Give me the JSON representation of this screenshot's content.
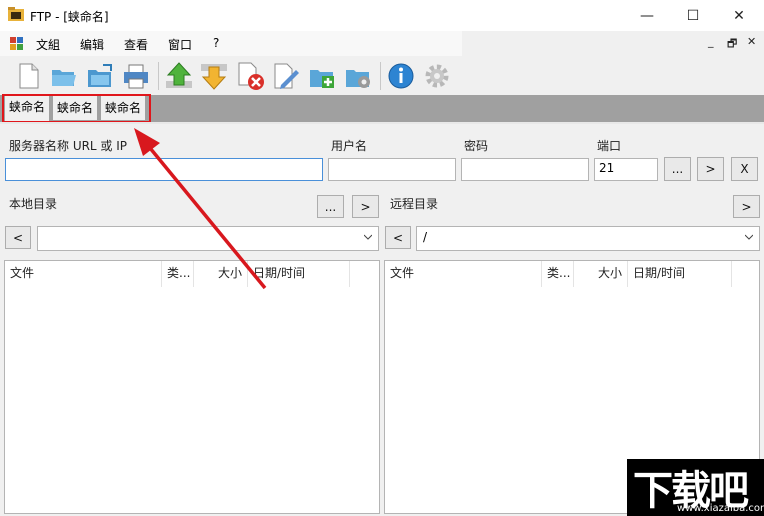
{
  "window": {
    "title": "FTP - [蛱命名]",
    "minimize": "—",
    "maximize": "☐",
    "close": "✕"
  },
  "menu": {
    "items": [
      "文組",
      "编辑",
      "查看",
      "窗口",
      "?"
    ],
    "mdi_min": "_",
    "mdi_restore": "🗗",
    "mdi_close": "✕"
  },
  "toolbar": {
    "icons": [
      "new-file-icon",
      "open-folder-icon",
      "save-folder-icon",
      "print-icon",
      "upload-icon",
      "download-icon",
      "delete-icon",
      "edit-icon",
      "new-folder-icon",
      "folder-settings-icon",
      "info-icon",
      "settings-gear-icon"
    ]
  },
  "tabs": [
    "蛱命名",
    "蛱命名",
    "蛱命名"
  ],
  "connection": {
    "server_label": "服务器名称 URL 或 IP",
    "user_label": "用户名",
    "password_label": "密码",
    "port_label": "端口",
    "server_value": "",
    "user_value": "",
    "password_value": "",
    "port_value": "21",
    "more_btn": "...",
    "go_btn": ">",
    "x_btn": "X"
  },
  "local": {
    "label": "本地目录",
    "browse_btn": "...",
    "go_btn": ">",
    "back_btn": "<",
    "path": "",
    "columns": [
      "文件",
      "类...",
      "大小",
      "日期/时间"
    ]
  },
  "remote": {
    "label": "远程目录",
    "go_btn": ">",
    "back_btn": "<",
    "path": "/",
    "columns": [
      "文件",
      "类...",
      "大小",
      "日期/时间"
    ]
  },
  "watermark": {
    "text": "下载吧",
    "url": "www.xiazaiba.com"
  },
  "colors": {
    "highlight": "#e0161b",
    "tabstrip": "#a0a0a0",
    "accent_input": "#4a90d9"
  }
}
